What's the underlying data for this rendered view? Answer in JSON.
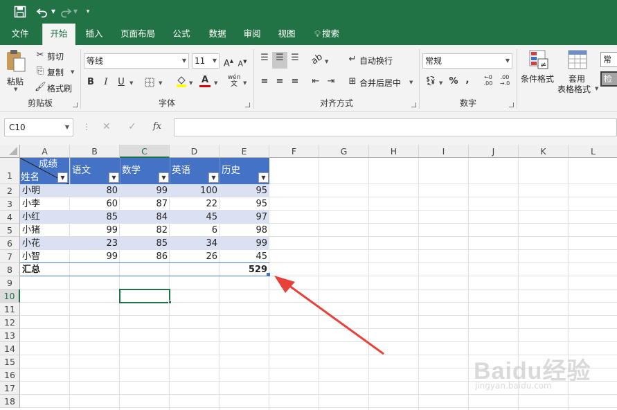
{
  "quick_access": {
    "save_icon": "save-icon",
    "undo_icon": "undo-icon",
    "redo_icon": "redo-icon",
    "customize_icon": "customize-icon"
  },
  "tabs": [
    "文件",
    "开始",
    "插入",
    "页面布局",
    "公式",
    "数据",
    "审阅",
    "视图",
    "搜索"
  ],
  "active_tab": "开始",
  "ribbon": {
    "clipboard": {
      "paste": "粘贴",
      "cut": "剪切",
      "copy": "复制",
      "format_painter": "格式刷",
      "label": "剪贴板"
    },
    "font": {
      "font_name": "等线",
      "font_size": "11",
      "bold": "B",
      "italic": "I",
      "underline": "U",
      "label": "字体",
      "grow": "A",
      "shrink": "A",
      "phonetic": "wén"
    },
    "alignment": {
      "wrap_text": "自动换行",
      "merge_center": "合并后居中",
      "label": "对齐方式"
    },
    "number": {
      "format": "常规",
      "percent": "%",
      "comma": ",",
      "inc_decimal": ".00",
      "dec_decimal": ".0",
      "label": "数字"
    },
    "styles": {
      "conditional": "条件格式",
      "format_as_table_1": "套用",
      "format_as_table_2": "表格格式",
      "style_normal": "常",
      "style_check": "检"
    }
  },
  "formula_bar": {
    "name_box": "C10",
    "fx": "fx",
    "cancel": "✕",
    "enter": "✓",
    "formula": ""
  },
  "columns": [
    "A",
    "B",
    "C",
    "D",
    "E",
    "F",
    "G",
    "H",
    "I",
    "J",
    "K",
    "L"
  ],
  "selected_column": "C",
  "rows": [
    "1",
    "2",
    "3",
    "4",
    "5",
    "6",
    "7",
    "8",
    "9",
    "10",
    "11",
    "12",
    "13",
    "14",
    "15",
    "16",
    "17",
    "18"
  ],
  "selected_row": "10",
  "table": {
    "header_diag_top": "成绩",
    "header_diag_bottom": "姓名",
    "headers": [
      "语文",
      "数学",
      "英语",
      "历史"
    ],
    "rows": [
      [
        "小明",
        "80",
        "99",
        "100",
        "95"
      ],
      [
        "小李",
        "60",
        "87",
        "22",
        "95"
      ],
      [
        "小红",
        "85",
        "84",
        "45",
        "97"
      ],
      [
        "小猪",
        "99",
        "82",
        "6",
        "98"
      ],
      [
        "小花",
        "23",
        "85",
        "34",
        "99"
      ],
      [
        "小智",
        "99",
        "86",
        "26",
        "45"
      ]
    ],
    "total_label": "汇总",
    "total_value": "529"
  },
  "watermark": {
    "text": "Baidu经验",
    "url": "jingyan.baidu.com"
  },
  "colors": {
    "excel_green": "#217346",
    "table_header": "#4472c4",
    "band": "#d9e1f2",
    "arrow": "#e8413a"
  }
}
